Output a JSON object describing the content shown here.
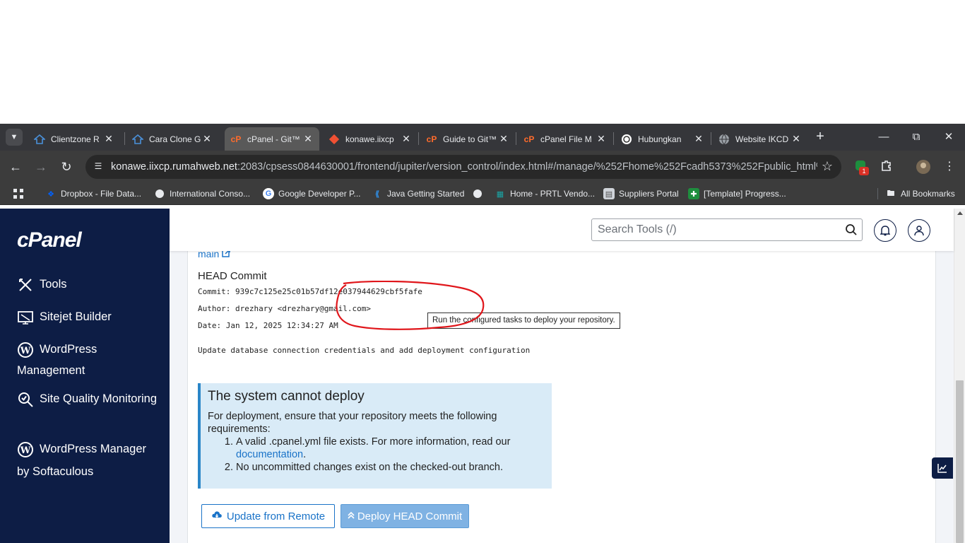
{
  "browser": {
    "tabs": [
      {
        "label": "Clientzone R",
        "icon": "clientzone-icon",
        "color": "#4a90d9"
      },
      {
        "label": "Cara Clone G",
        "icon": "clientzone-icon",
        "color": "#4a90d9"
      },
      {
        "label": "cPanel - Git™",
        "icon": "cpanel-icon",
        "color": "#ff6c2c",
        "active": true
      },
      {
        "label": "konawe.iixcp",
        "icon": "git-icon",
        "color": "#f05033"
      },
      {
        "label": "Guide to Git™",
        "icon": "cpanel-icon",
        "color": "#ff6c2c"
      },
      {
        "label": "cPanel File M",
        "icon": "cpanel-icon",
        "color": "#ff6c2c"
      },
      {
        "label": "Hubungkan",
        "icon": "openai-icon",
        "color": "#ffffff"
      },
      {
        "label": "Website IKCD",
        "icon": "globe-icon",
        "color": "#9aa0a6"
      }
    ],
    "url_host": "konawe.iixcp.rumahweb.net",
    "url_path": ":2083/cpsess0844630001/frontend/jupiter/version_control/index.html#/manage/%252Fhome%252Fcadh5373%252Fpublic_html%25...",
    "extension_badge": "1",
    "bookmarks": [
      {
        "label": "Dropbox - File Data...",
        "icon": "dropbox-icon",
        "color": "#0061fe"
      },
      {
        "label": "International Conso...",
        "icon": "globe-icon",
        "color": "#e8eaed"
      },
      {
        "label": "Google Developer P...",
        "icon": "google-icon",
        "color": "#ffffff"
      },
      {
        "label": "Java Getting Started",
        "icon": "vscode-icon",
        "color": "#2f8ee6"
      },
      {
        "label": "",
        "icon": "globe-icon",
        "color": "#e8eaed"
      },
      {
        "label": "Home - PRTL Vendo...",
        "icon": "prtl-icon",
        "color": "#1aa5a5"
      },
      {
        "label": "Suppliers Portal",
        "icon": "document-icon",
        "color": "#d0d4da"
      },
      {
        "label": "[Template] Progress...",
        "icon": "sheets-icon",
        "color": "#1e8e3e"
      }
    ],
    "all_bookmarks": "All Bookmarks"
  },
  "sidebar": {
    "logo": "cPanel",
    "items": [
      {
        "label": "Tools",
        "icon": "tools-icon"
      },
      {
        "label": "Sitejet Builder",
        "icon": "sitejet-icon"
      },
      {
        "label": "WordPress Management",
        "icon": "wordpress-icon"
      },
      {
        "label": "Site Quality Monitoring",
        "icon": "site-quality-icon"
      },
      {
        "label": "WordPress Manager by Softaculous",
        "icon": "wordpress-icon"
      }
    ]
  },
  "header": {
    "search_placeholder": "Search Tools (/)"
  },
  "main": {
    "branch": "main",
    "head_commit_title": "HEAD Commit",
    "commit_label": "Commit:",
    "commit_value": "939c7c125e25c01b57df12e037944629cbf5fafe",
    "author_label": "Author:",
    "author_value": "drezhary <drezhary@gmail.com>",
    "date_label": "Date:",
    "date_value": "Jan 12, 2025 12:34:27 AM",
    "message": "Update database connection credentials and add deployment configuration",
    "alert": {
      "title": "The system cannot deploy",
      "intro": "For deployment, ensure that your repository meets the following requirements:",
      "req1_prefix": "A valid .cpanel.yml file exists. For more information, read our",
      "req1_link": "documentation",
      "req1_suffix": ".",
      "req2": "No uncommitted changes exist on the checked-out branch."
    },
    "update_button": "Update from Remote",
    "deploy_button": "Deploy HEAD Commit",
    "tooltip": "Run the configured tasks to deploy your repository."
  },
  "colors": {
    "sidebar_bg": "#0d1d45",
    "link": "#1a73c8",
    "alert_bg": "#d9ebf7",
    "annotation": "#e0161b"
  }
}
